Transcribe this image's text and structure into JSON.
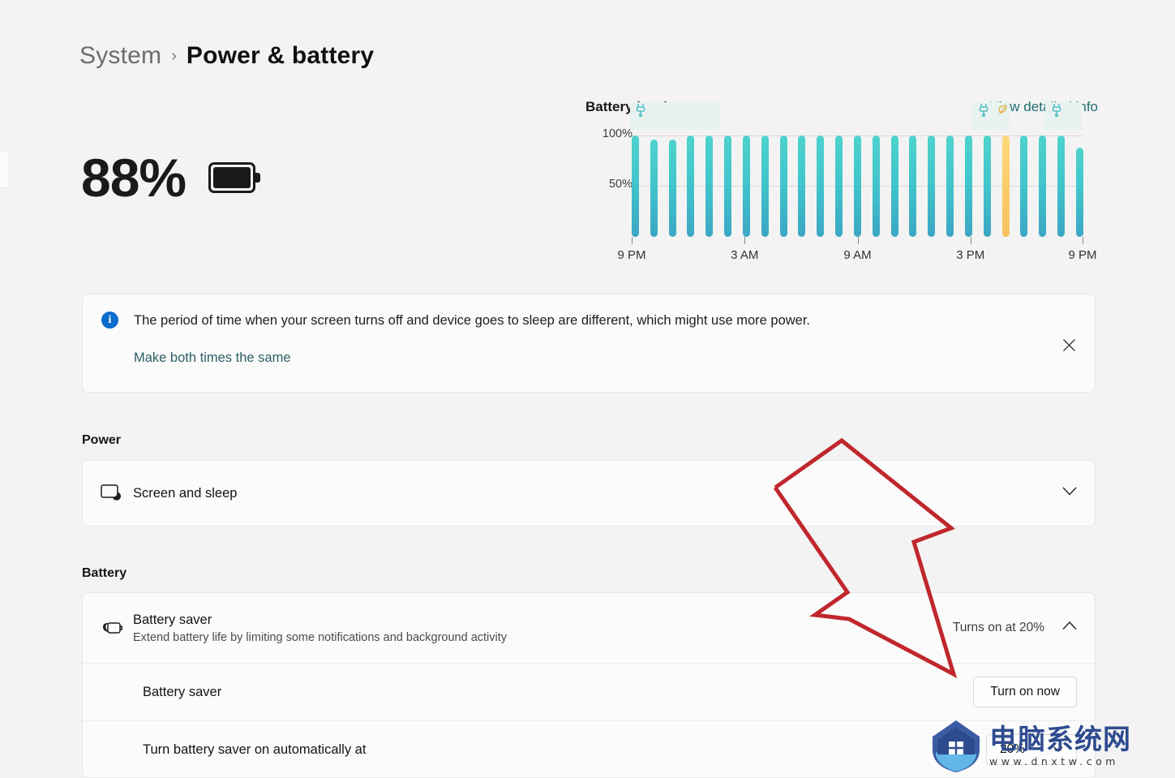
{
  "breadcrumb": {
    "parent": "System",
    "separator": "›",
    "current": "Power & battery"
  },
  "battery_status": {
    "percent_label": "88%",
    "icon": "battery-full-icon"
  },
  "chart_header": {
    "title": "Battery levels",
    "link": "View detailed info"
  },
  "chart_data": {
    "type": "bar",
    "title": "Battery levels",
    "xlabel": "",
    "ylabel": "",
    "ylim": [
      0,
      110
    ],
    "grid": true,
    "legend_position": "none",
    "ytick_labels": [
      "100%",
      "50%"
    ],
    "ytick_values": [
      100,
      50
    ],
    "xtick_labels": [
      "9 PM",
      "3 AM",
      "9 AM",
      "3 PM",
      "9 PM"
    ],
    "xtick_hours": [
      0,
      6,
      12,
      18,
      24
    ],
    "categories": [
      "9 PM",
      "10 PM",
      "11 PM",
      "12 AM",
      "1 AM",
      "2 AM",
      "3 AM",
      "4 AM",
      "5 AM",
      "6 AM",
      "7 AM",
      "8 AM",
      "9 AM",
      "10 AM",
      "11 AM",
      "12 PM",
      "1 PM",
      "2 PM",
      "3 PM",
      "4 PM",
      "5 PM",
      "6 PM",
      "7 PM",
      "8 PM",
      "9 PM"
    ],
    "values": [
      100,
      96,
      96,
      100,
      100,
      100,
      100,
      100,
      100,
      100,
      100,
      100,
      100,
      100,
      100,
      100,
      100,
      100,
      100,
      100,
      100,
      100,
      100,
      100,
      88
    ],
    "bar_colors": [
      "teal",
      "teal",
      "teal",
      "teal",
      "teal",
      "teal",
      "teal",
      "teal",
      "teal",
      "teal",
      "teal",
      "teal",
      "teal",
      "teal",
      "teal",
      "teal",
      "teal",
      "teal",
      "teal",
      "teal",
      "saver",
      "teal",
      "teal",
      "teal",
      "teal"
    ],
    "series": [
      {
        "name": "Battery level",
        "values": [
          100,
          96,
          96,
          100,
          100,
          100,
          100,
          100,
          100,
          100,
          100,
          100,
          100,
          100,
          100,
          100,
          100,
          100,
          100,
          100,
          100,
          100,
          100,
          100,
          88
        ]
      }
    ],
    "annotations": [
      {
        "type": "charging-plug-icon",
        "bar_index": 0,
        "label": "plugged in"
      },
      {
        "type": "charging-plug-icon",
        "bar_index": 19,
        "label": "plugged in"
      },
      {
        "type": "battery-saver-leaf-icon",
        "bar_index": 20,
        "label": "battery saver on"
      },
      {
        "type": "charging-plug-icon",
        "bar_index": 23,
        "label": "plugged in"
      }
    ],
    "charging_bands": [
      {
        "start_index": 0,
        "end_index": 4
      },
      {
        "start_index": 19,
        "end_index": 20
      },
      {
        "start_index": 23,
        "end_index": 24
      }
    ],
    "colors": {
      "bar_teal": "#41c6cc",
      "bar_saver": "#f7c95f",
      "grid": "#d9d9d9",
      "band": "#e8f2f1"
    }
  },
  "banner": {
    "icon": "info-icon",
    "glyph": "i",
    "message": "The period of time when your screen turns off and device goes to sleep are different, which might use more power.",
    "link": "Make both times the same",
    "close_label": "✕"
  },
  "sections": {
    "power": {
      "heading": "Power",
      "rows": [
        {
          "icon": "screen-sleep-icon",
          "title": "Screen and sleep",
          "value": "",
          "chevron": "down"
        }
      ]
    },
    "battery": {
      "heading": "Battery",
      "saver": {
        "icon": "battery-saver-icon",
        "title": "Battery saver",
        "subtitle": "Extend battery life by limiting some notifications and background activity",
        "value": "Turns on at 20%",
        "chevron": "up"
      },
      "subrows": [
        {
          "label": "Battery saver",
          "control": "button",
          "control_label": "Turn on now"
        },
        {
          "label": "Turn battery saver on automatically at",
          "control": "select",
          "control_value": "20%"
        }
      ]
    }
  },
  "watermark": {
    "cn": "电脑系统网",
    "url": "www.dnxtw.com"
  },
  "theme": {
    "page_bg": "#f3f3f3",
    "card_bg": "#fbfbfb",
    "accent_teal": "#41c6cc",
    "accent_yellow": "#f7c95f",
    "info_blue": "#0a6ccd",
    "link_teal": "#1f6f73",
    "annotation_red": "#c0272d"
  }
}
